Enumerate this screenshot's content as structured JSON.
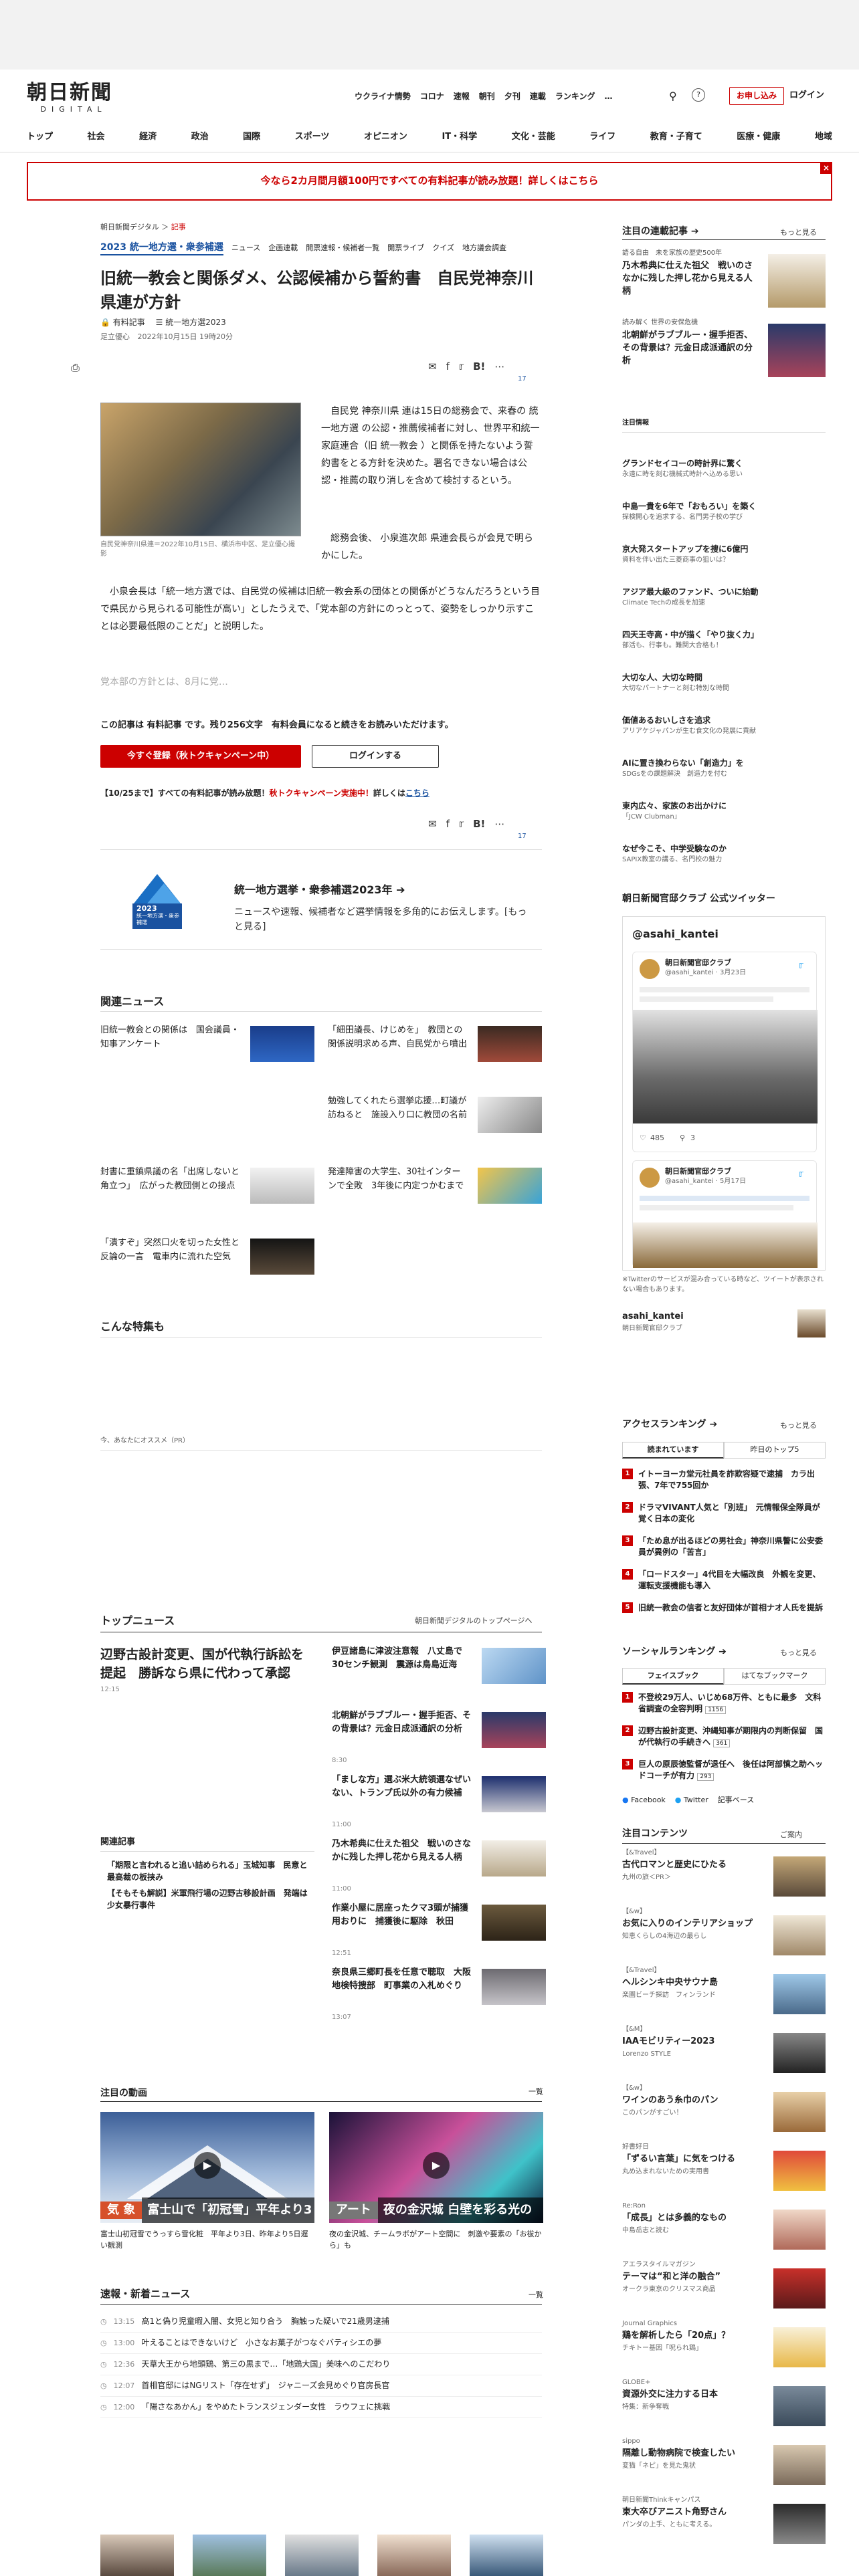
{
  "site": {
    "logo": "朝日新聞",
    "logo_sub": "DIGITAL"
  },
  "header_nav": [
    "ウクライナ情勢",
    "コロナ",
    "速報",
    "朝刊",
    "夕刊",
    "連載",
    "ランキング",
    "…"
  ],
  "header": {
    "search_icon": "search-icon",
    "help_icon": "help-icon",
    "trial": "お申し込み",
    "login": "ログイン"
  },
  "global_nav": [
    "トップ",
    "社会",
    "経済",
    "政治",
    "国際",
    "スポーツ",
    "オピニオン",
    "IT・科学",
    "文化・芸能",
    "ライフ",
    "教育・子育て",
    "医療・健康",
    "地域"
  ],
  "promo": {
    "text": "今なら2カ月間月額100円ですべての有料記事が読み放題！詳しくはこちら",
    "close": "×"
  },
  "article": {
    "crumb_site": "朝日新聞デジタル",
    "crumb_sep": " ＞ ",
    "crumb_section": "記事",
    "series_logo": "2023 統一地方選・衆参補選",
    "series_tabs": [
      "ニュース",
      "企画連載",
      "開票速報・候補者一覧",
      "開票ライブ",
      "クイズ",
      "地方議会調査"
    ],
    "headline": "旧統一教会と関係ダメ、公認候補から誓約書　自民党神奈川県連が方針",
    "paid": "有料記事",
    "series_link": "統一地方選2023",
    "author": "足立優心",
    "date": "2022年10月15日 19時20分",
    "comments_count": "17",
    "caption": "自民党神奈川県連＝2022年10月15日、横浜市中区、足立優心撮影",
    "p1": "自民党 神奈川県 連は15日の総務会で、来春の 統一地方選 の公認・推薦候補者に対し、世界平和統一家庭連合（旧 統一教会 ）と関係を持たないよう誓約書をとる方針を決めた。署名できない場合は公認・推薦の取り消しを含めて検討するという。",
    "p2": "総務会後、 小泉進次郎 県連会長らが会見で明らかにした。",
    "p3": "小泉会長は「統一地方選では、自民党の候補は旧統一教会系の団体との関係がどうなんだろうという目で県民から見られる可能性が高い」としたうえで、「党本部の方針にのっとって、姿勢をしっかり示すことは必要最低限のことだ」と説明した。",
    "p4": "党本部の方針とは、8月に党…",
    "paywall": "この記事は 有料記事 です。残り256文字　有料会員になると続きをお読みいただけます。",
    "register": "今すぐ登録（秋トクキャンペーン中）",
    "login": "ログインする",
    "notice_a": "【10/25まで】すべての有料記事が読み放題！",
    "notice_b": "秋トクキャンペーン実施中！",
    "notice_c": "詳しくは",
    "notice_d": "こちら"
  },
  "election": {
    "badge_year": "2023",
    "badge_text": "統一地方選・衆参補選",
    "title": "統一地方選挙・衆参補選2023年 ➔",
    "desc": "ニュースや速報、候補者など選挙情報を多角的にお伝えします。[もっと見る]"
  },
  "related": {
    "heading": "関連ニュース",
    "items": [
      "旧統一教会との関係は　国会議員・知事アンケート",
      "「細田議長、けじめを」　教団との関係説明求める声、自民党から噴出",
      "勉強してくれたら選挙応援…町議が訪ねると　施設入り口に教団の名前",
      "封書に重鎮県議の名「出席しないと角立つ」　広がった教団側との接点",
      "発達障害の大学生、30社インターンで全敗　3年後に内定つかむまで",
      "「潰すぞ」突然口火を切った女性と反論の一言　電車内に流れた空気"
    ]
  },
  "feature_heading": "こんな特集も",
  "recommend": "今、あなたにオススメ（PR）",
  "topnews": {
    "heading": "トップニュース",
    "link": "朝日新聞デジタルのトップページへ",
    "lead": "辺野古設計変更、国が代執行訴訟を提起　勝訴なら県に代わって承認",
    "lead_time": "12:15",
    "items": [
      {
        "t": "伊豆諸島に津波注意報　八丈島で30センチ観測　震源は鳥島近海",
        "tm": ""
      },
      {
        "t": "北朝鮮がラブブルー・握手拒否、その背景は？元金日成派通訳の分析",
        "tm": "8:30"
      },
      {
        "t": "「ましな方」選ぶ米大統領選なぜいない、トランプ氏以外の有力候補",
        "tm": "11:00"
      },
      {
        "t": "乃木希典に仕えた祖父　戦いのさなかに残した押し花から見える人柄",
        "tm": "11:00"
      },
      {
        "t": "作業小屋に居座ったクマ3頭が捕獲用おりに　捕獲後に駆除　秋田",
        "tm": "12:51"
      },
      {
        "t": "奈良県三郷町長を任意で聴取　大阪地検特捜部　町事業の入札めぐり",
        "tm": "13:07"
      }
    ],
    "related_heading": "関連記事",
    "related": [
      "「期限と言われると追い詰められる」玉城知事　民意と最高裁の板挟み",
      "【そもそも解説】米軍飛行場の辺野古移設計画　発端は少女暴行事件"
    ]
  },
  "video": {
    "heading": "注目の動画",
    "more": "一覧",
    "items": [
      {
        "cat": "気 象",
        "title": "富士山で「初冠雪」平年より3日遅れ",
        "cap": "富士山初冠雪でうっすら雪化粧　平年より3日、昨年より5日遅い観測"
      },
      {
        "cat": "アート",
        "title": "夜の金沢城 白壁を彩る光の祭",
        "cap": "夜の金沢城、チームラボがアート空間に　刺激や要素の「お祓から」も"
      }
    ]
  },
  "breaking": {
    "heading": "速報・新着ニュース",
    "more": "一覧",
    "items": [
      {
        "tm": "13:15",
        "t": "高1と偽り児童暇入闇、女児と知り合う　胸触った疑いで21歳男逮捕"
      },
      {
        "tm": "13:00",
        "t": "叶えることはできないけど　小さなお菓子がつなぐバティシエの夢"
      },
      {
        "tm": "12:36",
        "t": "天草大王から地頭鶏、第三の黒まで…「地鶏大国」美味へのこだわり"
      },
      {
        "tm": "12:07",
        "t": "首相官邸にはNGリスト「存在せず」　ジャニーズ会見めぐり官房長官"
      },
      {
        "tm": "12:00",
        "t": "「陽さなあかん」をやめたトランスジェンダー女性　ラウフェに挑戦"
      }
    ]
  },
  "right": {
    "series_heading": "注目の連載記事 ➔",
    "series_more": "もっと見る",
    "series": [
      {
        "tag": "語る自由　未を家族の歴史500年",
        "t": "乃木希典に仕えた祖父　戦いのさなかに残した押し花から見える人柄"
      },
      {
        "tag": "読み解く 世界の安保危機",
        "t": "北朝鮮がラブブルー・握手拒否、その背景は？元金日成派通訳の分析"
      }
    ],
    "ad_label": "注目情報",
    "pr": [
      {
        "t": "グランドセイコーの時計界に驚く",
        "s": "永遠に時を刻む機械式時計へ込める思い"
      },
      {
        "t": "中島一貴を6年で「おもろい」を築く",
        "s": "探検開心を追求する、名門男子校の学び"
      },
      {
        "t": "京大発スタートアップを捜に6億円",
        "s": "資料を伴い出た三菱商事の狙いは？"
      },
      {
        "t": "アジア最大級のファンド、ついに始動",
        "s": "Climate Techの成長を加速"
      },
      {
        "t": "四天王寺高・中が描く「やり抜く力」",
        "s": "部活も、行事も。難関大合格も！"
      },
      {
        "t": "大切な人、大切な時間",
        "s": "大切なパートナーと刻む特別な時間"
      },
      {
        "t": "価値あるおいしさを追求",
        "s": "アリアケジャパンが生む食文化の発展に貢献"
      },
      {
        "t": "AIに置き換わらない「創造力」を",
        "s": "SDGsをの課題解決　創造力を付む"
      },
      {
        "t": "東内広々、家族のお出かけに",
        "s": "「JCW Clubman」"
      },
      {
        "t": "なぜ今こそ、中学受験なのか",
        "s": "SAPIX教室の講る、名門校の魅力"
      }
    ],
    "twitter_heading": "朝日新聞官邸クラブ 公式ツイッター",
    "twitter_handle": "@asahi_kantei",
    "twitter_name": "朝日新聞官邸クラブ",
    "tweet1_user": "@asahi_kantei · 3月23日",
    "tweet1_likes": "485",
    "tweet1_replies": "3",
    "tweet2_user": "@asahi_kantei · 5月17日",
    "twitter_note": "※Twitterのサービスが混み合っている時など、ツイートが表示されない場合もあります。",
    "account_name": "asahi_kantei",
    "account_sub": "朝日新聞官邸クラブ",
    "access_heading": "アクセスランキング ➔",
    "access_more": "もっと見る",
    "access_tabs": [
      "読まれています",
      "昨日のトップ5"
    ],
    "access": [
      "イトーヨーカ堂元社員を詐欺容疑で逮捕　カラ出張、7年で755回か",
      "ドラマVIVANT人気と「別班」　元情報保全隊員が覚く日本の変化",
      "「ため息が出るほどの男社会」神奈川県警に公安委員が異例の「苦言」",
      "「ロードスター」4代目を大幅改良　外観を変更、運転支援機能も導入",
      "旧統一教会の信者と友好団体が首相ナオ人氏を提訴"
    ],
    "social_heading": "ソーシャルランキング ➔",
    "social_more": "もっと見る",
    "social_tabs": [
      "フェイスブック",
      "はてなブックマーク"
    ],
    "social": [
      {
        "t": "不登校29万人、いじめ68万件、ともに最多　文科省調査の全容判明",
        "c": "1156"
      },
      {
        "t": "辺野古設計変更、沖縄知事が期限内の判断保留　国が代執行の手続きへ",
        "c": "361"
      },
      {
        "t": "巨人の原辰徳監督が退任へ　後任は阿部慎之助ヘッドコーチが有力",
        "c": "293"
      }
    ],
    "social_links": [
      "Facebook",
      "Twitter",
      "記事ベース"
    ],
    "content_heading": "注目コンテンツ",
    "content_more": "ご案内",
    "contents": [
      {
        "tag": "【&Travel】",
        "t": "古代ロマンと歴史にひたる",
        "s": "九州の旅＜PR＞"
      },
      {
        "tag": "【&w】",
        "t": "お気に入りのインテリアショップ",
        "s": "知恵くらしの4海辺の最らし"
      },
      {
        "tag": "【&Travel】",
        "t": "ヘルシンキ中央サウナ島",
        "s": "楽園ビーチ探訪　フィンランド"
      },
      {
        "tag": "【&M】",
        "t": "IAAモビリティー2023",
        "s": "Lorenzo STYLE"
      },
      {
        "tag": "【&w】",
        "t": "ワインのあう糸巾のパン",
        "s": "このパンがすごい！"
      },
      {
        "tag": "好書好日",
        "t": "「ずるい言葉」に気をつける",
        "s": "丸め込まれないための実用書"
      },
      {
        "tag": "Re:Ron",
        "t": "「成長」とは多義的なもの",
        "s": "中島岳志と読む"
      },
      {
        "tag": "アエラスタイルマガジン",
        "t": "テーマは“和と洋の融合”",
        "s": "オークラ東京のクリスマス商品"
      },
      {
        "tag": "Journal Graphics",
        "t": "鶏を解析したら「20点」？",
        "s": "チキトー基因「呪られ鶏」"
      },
      {
        "tag": "GLOBE+",
        "t": "資源外交に注力する日本",
        "s": "特集：新争奪戦"
      },
      {
        "tag": "sippo",
        "t": "隔離し動物病院で検査したい",
        "s": "変猫「ネピ」を見た鬼状"
      },
      {
        "tag": "朝日新聞Thinkキャンパス",
        "t": "東大卒びアニスト角野さん",
        "s": "パンダの上手、ともに考える。"
      }
    ]
  }
}
